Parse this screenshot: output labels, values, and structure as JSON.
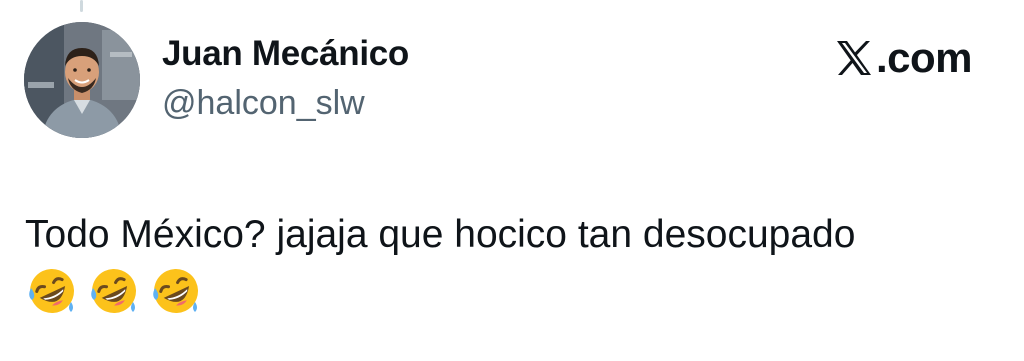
{
  "author": {
    "display_name": "Juan Mecánico",
    "handle": "@halcon_slw",
    "avatar_icon": "mechanic-avatar"
  },
  "site": {
    "logo_icon": "x-logo-icon",
    "domain_text": ".com"
  },
  "tweet": {
    "text": "Todo México? jajaja que hocico tan desocupado",
    "emojis": [
      "rolling-on-floor-laughing-icon",
      "rolling-on-floor-laughing-icon",
      "rolling-on-floor-laughing-icon"
    ]
  },
  "colors": {
    "text": "#0f1419",
    "handle": "#536471",
    "thread_line": "#cfd9de",
    "emoji_face": "#fcc21b"
  }
}
